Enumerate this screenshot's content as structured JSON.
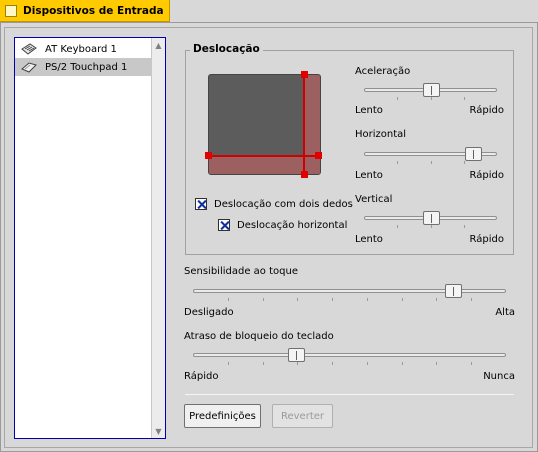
{
  "window": {
    "tab_title": "Dispositivos de Entrada"
  },
  "devices": [
    {
      "label": "AT Keyboard 1",
      "icon": "keyboard-icon",
      "selected": false
    },
    {
      "label": "PS/2 Touchpad 1",
      "icon": "touchpad-icon",
      "selected": true
    }
  ],
  "scrolling": {
    "group_title": "Deslocação",
    "two_finger_label": "Deslocação com dois dedos",
    "two_finger_checked": true,
    "horizontal_label": "Deslocação horizontal",
    "horizontal_checked": true,
    "acceleration": {
      "label": "Aceleração",
      "min_label": "Lento",
      "max_label": "Rápido",
      "value": 0.5
    },
    "horizontal": {
      "label": "Horizontal",
      "min_label": "Lento",
      "max_label": "Rápido",
      "value": 0.82
    },
    "vertical": {
      "label": "Vertical",
      "min_label": "Lento",
      "max_label": "Rápido",
      "value": 0.5
    }
  },
  "tap_sensitivity": {
    "label": "Sensibilidade ao toque",
    "min_label": "Desligado",
    "max_label": "Alta",
    "value": 0.83
  },
  "keyboard_lock_delay": {
    "label": "Atraso de bloqueio do teclado",
    "min_label": "Rápido",
    "max_label": "Nunca",
    "value": 0.33
  },
  "buttons": {
    "defaults_label": "Predefinições",
    "revert_label": "Reverter",
    "revert_enabled": false
  },
  "colors": {
    "tab": "#ffcb00",
    "list_border": "#0000b0",
    "scroll_region": "#9c6060",
    "pad": "#5c5c5c",
    "handle": "#e00000"
  }
}
